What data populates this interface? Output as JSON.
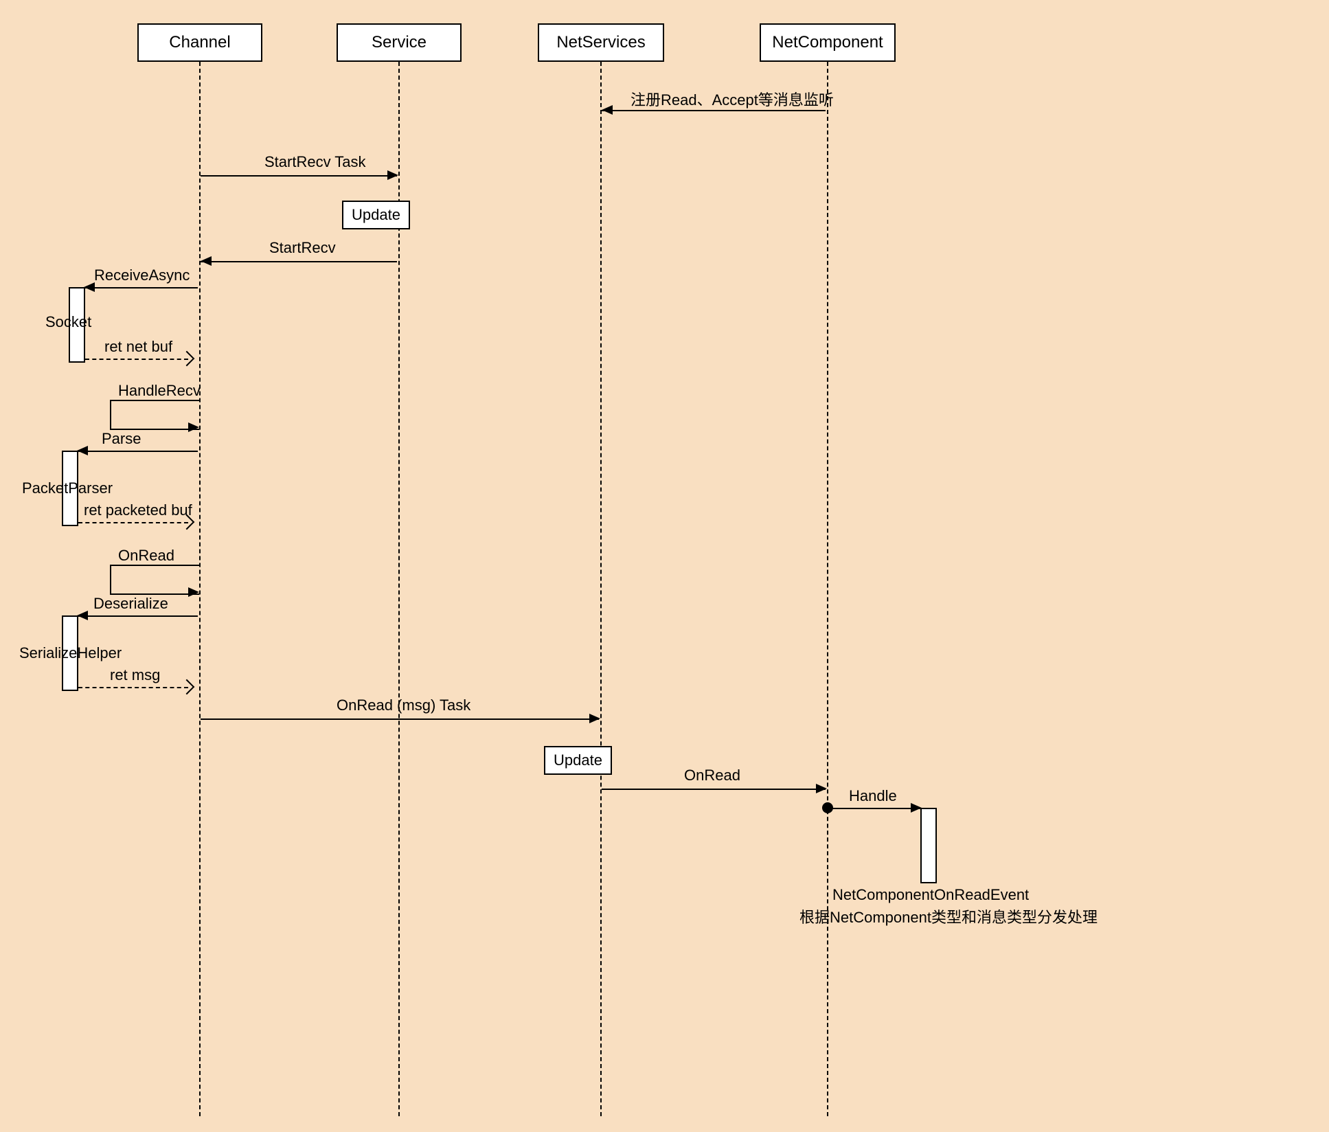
{
  "lifelines": {
    "channel": "Channel",
    "service": "Service",
    "netservices": "NetServices",
    "netcomponent": "NetComponent"
  },
  "messages": {
    "register": "注册Read、Accept等消息监听",
    "startRecvTask": "StartRecv Task",
    "update1": "Update",
    "startRecv": "StartRecv",
    "receiveAsync": "ReceiveAsync",
    "socket": "Socket",
    "retNetBuf": "ret net buf",
    "handleRecv": "HandleRecv",
    "parse": "Parse",
    "packetParser": "PacketParser",
    "retPacketedBuf": "ret packeted buf",
    "onRead": "OnRead",
    "deserialize": "Deserialize",
    "serializeHelper": "SerializeHelper",
    "retMsg": "ret msg",
    "onReadMsgTask": "OnRead (msg)  Task",
    "update2": "Update",
    "onRead2": "OnRead",
    "handle": "Handle",
    "eventName": "NetComponentOnReadEvent",
    "dispatch": "根据NetComponent类型和消息类型分发处理"
  }
}
